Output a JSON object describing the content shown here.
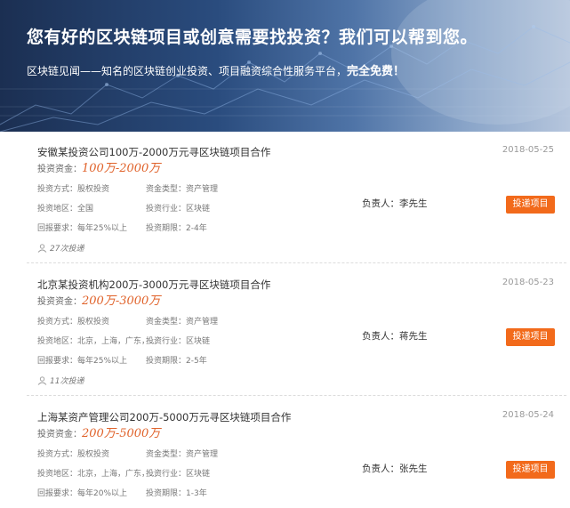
{
  "banner": {
    "title": "您有好的区块链项目或创意需要找投资？我们可以帮到您。",
    "subtitle": "区块链见闻——知名的区块链创业投资、项目融资综合性服务平台，",
    "subtitle_bold": "完全免费！"
  },
  "labels": {
    "amount": "投资资金：",
    "method": "投资方式：",
    "fund_type": "资金类型：",
    "region": "投资地区：",
    "industry": "投资行业：",
    "return": "回报要求：",
    "period": "投资期限：",
    "person": "负责人：",
    "submit": "投递项目"
  },
  "projects": [
    {
      "title": "安徽某投资公司100万-2000万元寻区块链项目合作",
      "date": "2018-05-25",
      "amount": "100万-2000万",
      "method": "股权投资",
      "fund_type": "资产管理",
      "region": "全国",
      "industry": "区块链",
      "return": "每年25%以上",
      "period": "2-4年",
      "submits": "27次投递",
      "person": "李先生"
    },
    {
      "title": "北京某投资机构200万-3000万元寻区块链项目合作",
      "date": "2018-05-23",
      "amount": "200万-3000万",
      "method": "股权投资",
      "fund_type": "资产管理",
      "region": "北京，上海，广东，...",
      "industry": "区块链",
      "return": "每年25%以上",
      "period": "2-5年",
      "submits": "11次投递",
      "person": "蒋先生"
    },
    {
      "title": "上海某资产管理公司200万-5000万元寻区块链项目合作",
      "date": "2018-05-24",
      "amount": "200万-5000万",
      "method": "股权投资",
      "fund_type": "资产管理",
      "region": "北京，上海，广东，...",
      "industry": "区块链",
      "return": "每年20%以上",
      "period": "1-3年",
      "submits": "",
      "person": "张先生"
    }
  ]
}
